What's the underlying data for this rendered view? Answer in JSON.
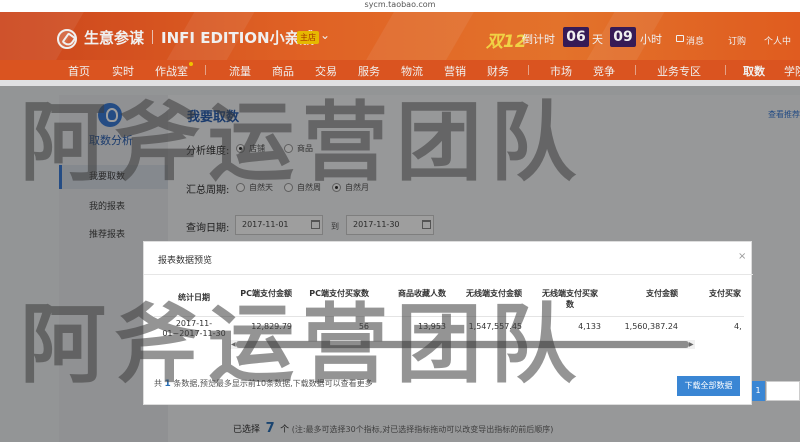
{
  "browser": {
    "url": "sycm.taobao.com"
  },
  "header": {
    "brand_name": "生意参谋",
    "edition": "INFI EDITION小亲戚",
    "edition_badge": "主店",
    "promo_text": "双12",
    "countdown_label": "倒计时",
    "countdown_days": "06",
    "countdown_day_unit": "天",
    "countdown_hours": "09",
    "countdown_hour_unit": "小时",
    "messages_label": "消息",
    "subscribe_label": "订购",
    "personal_center_label": "个人中"
  },
  "nav": {
    "items": [
      "首页",
      "实时",
      "作战室",
      "流量",
      "商品",
      "交易",
      "服务",
      "物流",
      "营销",
      "财务",
      "市场",
      "竞争",
      "业务专区",
      "取数",
      "学院"
    ],
    "active": "取数"
  },
  "sidebar": {
    "title": "取数分析",
    "items": [
      "我要取数",
      "我的报表",
      "推荐报表"
    ],
    "active": "我要取数"
  },
  "main": {
    "page_title": "我要取数",
    "right_link": "查看推荐",
    "dimension_label": "分析维度:",
    "dimension_options": [
      "店铺",
      "商品"
    ],
    "dimension_selected": "店铺",
    "period_label": "汇总周期:",
    "period_options": [
      "自然天",
      "自然周",
      "自然月"
    ],
    "period_selected": "自然月",
    "query_date_label": "查询日期:",
    "date_start": "2017-11-01",
    "date_to": "到",
    "date_end": "2017-11-30",
    "selected_label": "已选择",
    "selected_count": "7",
    "selected_unit": "个",
    "selected_note": "(注:最多可选择30个指标,对已选择指标拖动可以改变导出指标的前后顺序)",
    "page_number": "1"
  },
  "modal": {
    "title": "报表数据预览",
    "close": "×",
    "columns": [
      "统计日期",
      "PC端支付金额",
      "PC端支付买家数",
      "商品收藏人数",
      "无线端支付金额",
      "无线端支付买家数",
      "支付金额",
      "支付买家"
    ],
    "row": [
      "2017-11-01~2017-11-30",
      "12,829.79",
      "56",
      "13,953",
      "1,547,557.45",
      "4,133",
      "1,560,387.24",
      "4,"
    ],
    "footnote_prefix": "共",
    "footnote_count": "1",
    "footnote_suffix": "条数据,预览最多显示前10条数据,下载数据可以查看更多",
    "download_button": "下载全部数据"
  },
  "watermark": {
    "text": "阿斧运营团队"
  },
  "colors": {
    "header_orange": "#ef6a28",
    "accent_blue": "#3a86d4",
    "countdown_bg": "#3a1d5c",
    "promo_yellow": "#ffe04a"
  }
}
